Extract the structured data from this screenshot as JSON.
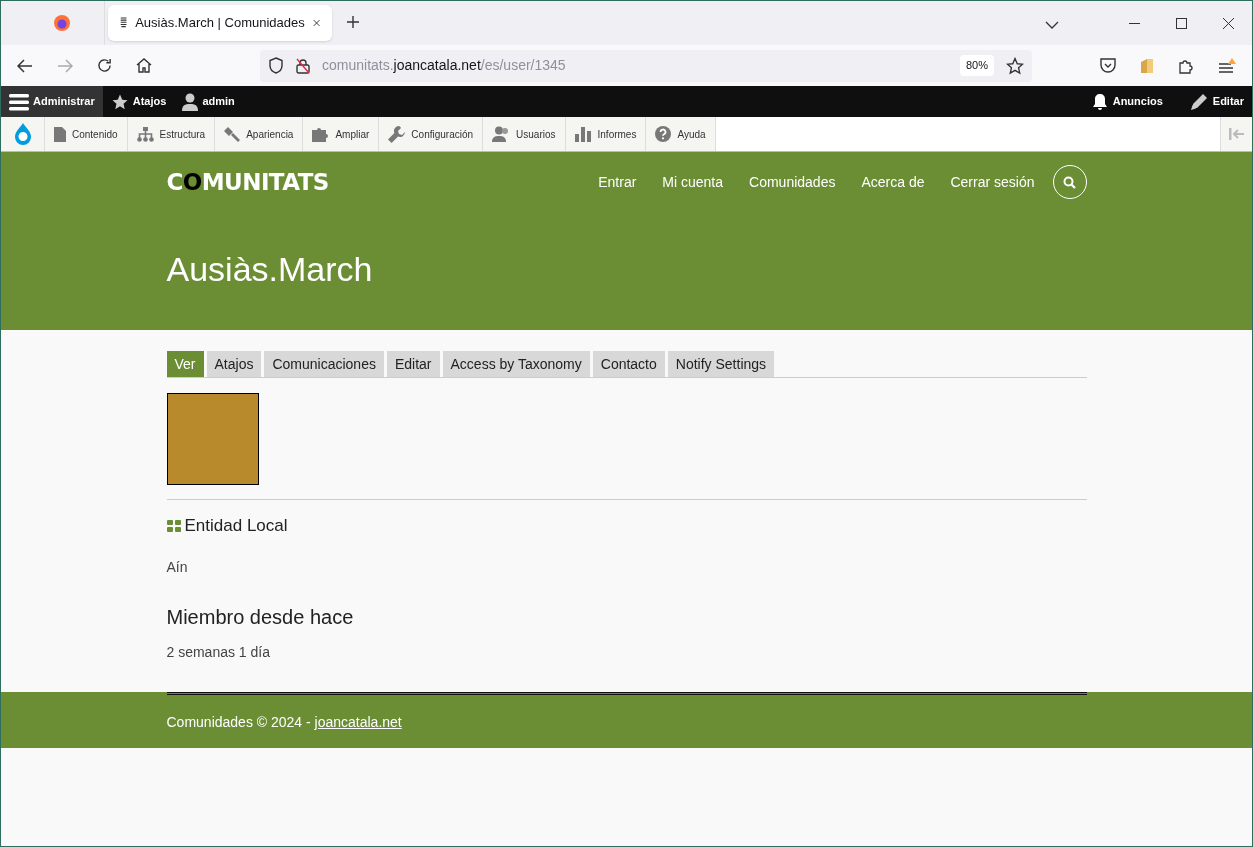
{
  "browser": {
    "tab_title": "Ausiàs.March | Comunidades",
    "url_domain_prefix": "comunitats.",
    "url_domain": "joancatala.net",
    "url_path": "/es/user/1345",
    "zoom": "80%"
  },
  "admin_bar": {
    "left": [
      {
        "kind": "menu",
        "label": "Administrar",
        "selected": true
      },
      {
        "kind": "star",
        "label": "Atajos",
        "selected": false
      },
      {
        "kind": "user",
        "label": "admin",
        "selected": false
      }
    ],
    "right": [
      {
        "kind": "bell",
        "label": "Anuncios"
      },
      {
        "kind": "pencil",
        "label": "Editar"
      }
    ]
  },
  "admin_menu": [
    {
      "kind": "file",
      "label": "Contenido"
    },
    {
      "kind": "tree",
      "label": "Estructura"
    },
    {
      "kind": "brush",
      "label": "Apariencia"
    },
    {
      "kind": "puzzle",
      "label": "Ampliar"
    },
    {
      "kind": "wrench",
      "label": "Configuración"
    },
    {
      "kind": "users",
      "label": "Usuarios"
    },
    {
      "kind": "bars",
      "label": "Informes"
    },
    {
      "kind": "help",
      "label": "Ayuda"
    }
  ],
  "site": {
    "logo_before": "C",
    "logo_o": "O",
    "logo_after": "MUNITATS",
    "nav": [
      "Entrar",
      "Mi cuenta",
      "Comunidades",
      "Acerca de",
      "Cerrar sesión"
    ]
  },
  "page_title": "Ausiàs.March",
  "tabs": [
    {
      "label": "Ver",
      "selected": true
    },
    {
      "label": "Atajos",
      "selected": false
    },
    {
      "label": "Comunicaciones",
      "selected": false
    },
    {
      "label": "Editar",
      "selected": false
    },
    {
      "label": "Access by Taxonomy",
      "selected": false
    },
    {
      "label": "Contacto",
      "selected": false
    },
    {
      "label": "Notify Settings",
      "selected": false
    }
  ],
  "fields": [
    {
      "label": "Entidad Local",
      "value": "Aín",
      "icon": true
    },
    {
      "label": "Miembro desde hace",
      "value": "2 semanas 1 día",
      "icon": false
    }
  ],
  "footer": {
    "text": "Comunidades © 2024 - ",
    "link": "joancatala.net"
  }
}
